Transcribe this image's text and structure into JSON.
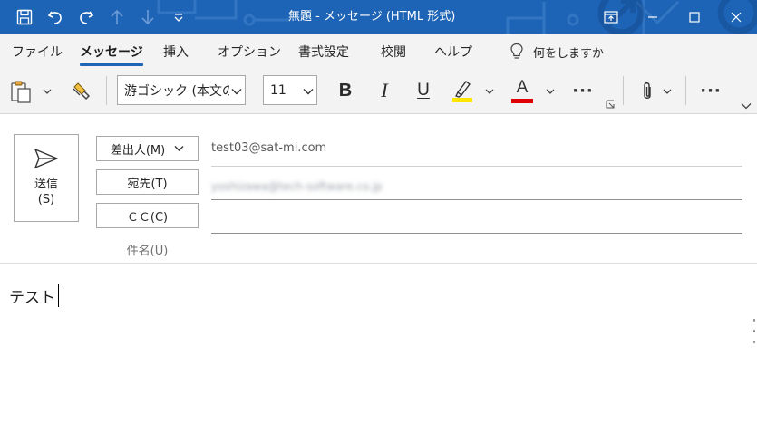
{
  "window": {
    "title": "無題  -  メッセージ (HTML 形式)"
  },
  "quick_access": {
    "icons": [
      "save-icon",
      "undo-icon",
      "redo-icon",
      "arrow-up-icon",
      "arrow-down-icon",
      "customize-qat-icon"
    ]
  },
  "window_controls": {
    "icons": [
      "ribbon-display-icon",
      "minimize-icon",
      "maximize-icon",
      "close-icon"
    ]
  },
  "ribbon": {
    "tabs": [
      {
        "label": "ファイル",
        "active": false
      },
      {
        "label": "メッセージ",
        "active": true
      },
      {
        "label": "挿入",
        "active": false
      },
      {
        "label": "オプション",
        "active": false
      },
      {
        "label": "書式設定",
        "active": false
      },
      {
        "label": "校閲",
        "active": false
      },
      {
        "label": "ヘルプ",
        "active": false
      }
    ],
    "tell_me": "何をしますか"
  },
  "toolbar": {
    "font_name": "游ゴシック (本文の",
    "font_size": "11",
    "bold": "B",
    "italic": "I",
    "underline": "U",
    "font_color_letter": "A",
    "more_dots": "···"
  },
  "colors": {
    "title_bar": "#1e64b6",
    "accent": "#1e64b6",
    "highlight_yellow": "#ffe600",
    "font_color_red": "#e00000"
  },
  "compose": {
    "send_label": "送信",
    "send_shortcut": "(S)",
    "from_button": "差出人(M)",
    "to_button": "宛先(T)",
    "cc_button": "ＣＣ(C)",
    "subject_label": "件名(U)",
    "from_value": "test03@sat-mi.com",
    "to_value": "yoshizawa@tech-software.co.jp",
    "cc_value": "",
    "subject_value": ""
  },
  "body": {
    "text": "テスト"
  }
}
